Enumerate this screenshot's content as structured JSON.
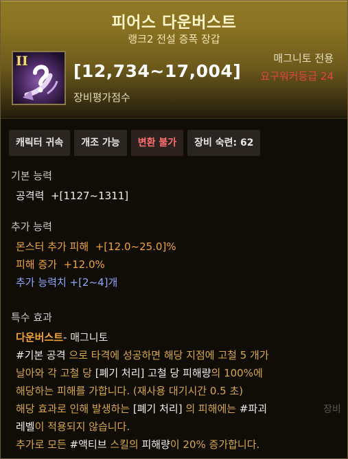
{
  "item": {
    "name": "피어스 다운버스트",
    "subtitle": "랭크2 전설 증폭 장갑",
    "grade_mark": "II",
    "icon": "glove-arc-icon",
    "score": "[12,734~17,004]",
    "score_label": "장비평가점수",
    "class_restriction": "매그니토 전용",
    "level_requirement": "요구워커등급 24"
  },
  "tags": [
    {
      "label": "캐릭터 귀속",
      "style": "normal"
    },
    {
      "label": "개조 가능",
      "style": "normal"
    },
    {
      "label": "변환 불가",
      "style": "warn"
    },
    {
      "label": "장비 숙련: 62",
      "style": "normal"
    }
  ],
  "base": {
    "heading": "기본 능력",
    "lines": [
      {
        "label": "공격력",
        "value": "+[1127~1311]"
      }
    ]
  },
  "extra": {
    "heading": "추가 능력",
    "lines": [
      {
        "label": "몬스터 추가 피해",
        "value": "+[12.0~25.0]%"
      },
      {
        "label": "피해 증가",
        "value": "+12.0%"
      }
    ],
    "extra_count": "추가 능력치 +[2~4]개"
  },
  "special": {
    "heading": "특수 효과",
    "effect_name": "다운버스트",
    "effect_suffix": "- 매그니토",
    "desc": [
      [
        {
          "t": "#기본 공격",
          "c": "w"
        },
        {
          "t": " 으로 타격에 성공하면 해당 지점에 고철 5 개가",
          "c": "o"
        }
      ],
      [
        {
          "t": "날아와 각 고철 당 ",
          "c": "o"
        },
        {
          "t": "[폐기 처리]",
          "c": "w"
        },
        {
          "t": " 고철 당 ",
          "c": "w"
        },
        {
          "t": "피해량",
          "c": "w"
        },
        {
          "t": "의 100%에",
          "c": "o"
        }
      ],
      [
        {
          "t": "해당하는 피해를 가합니다. (재사용 대기시간 0.5 초)",
          "c": "o"
        }
      ],
      [
        {
          "t": "해당 효과로 인해 발생하는 ",
          "c": "o"
        },
        {
          "t": "[폐기 처리]",
          "c": "w"
        },
        {
          "t": " 의 피해에는 ",
          "c": "o"
        },
        {
          "t": "#파괴",
          "c": "w"
        }
      ],
      [
        {
          "t": "레벨",
          "c": "w"
        },
        {
          "t": "이 적용되지 않습니다.",
          "c": "o"
        }
      ],
      [
        {
          "t": "추가로 모든 ",
          "c": "o"
        },
        {
          "t": "#액티브",
          "c": "w"
        },
        {
          "t": " 스킬의 ",
          "c": "o"
        },
        {
          "t": "피해량",
          "c": "w"
        },
        {
          "t": "이 20% 증가합니다.",
          "c": "o"
        }
      ]
    ]
  },
  "background_text": [
    "장비"
  ],
  "colors": {
    "header_gold": "#8f7826",
    "orange": "#f0a43c",
    "blue": "#8fa8ff",
    "red": "#e34545",
    "desc_gold": "#d8a84a",
    "white": "#f0f0f0"
  }
}
